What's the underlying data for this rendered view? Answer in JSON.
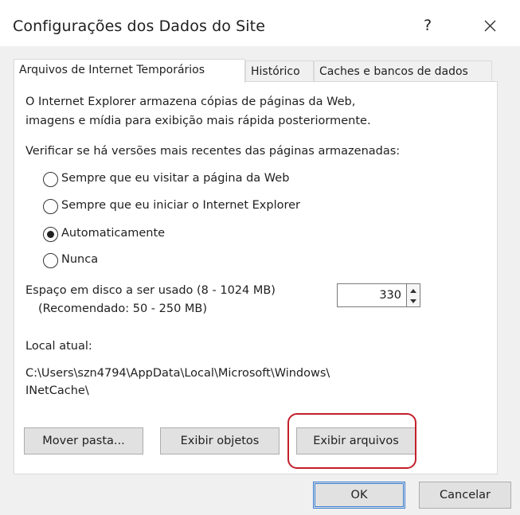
{
  "window": {
    "title": "Configurações dos Dados do Site",
    "help_label": "?"
  },
  "tabs": [
    {
      "label": "Arquivos de Internet Temporários",
      "active": true
    },
    {
      "label": "Histórico",
      "active": false
    },
    {
      "label": "Caches e bancos de dados",
      "active": false
    }
  ],
  "panel": {
    "description_line1": "O Internet Explorer armazena cópias de páginas da Web,",
    "description_line2": "imagens e mídia para exibição mais rápida posteriormente.",
    "check_label": "Verificar se há versões mais recentes das páginas armazenadas:",
    "radio_options": [
      {
        "label": "Sempre que eu visitar a página da Web",
        "selected": false
      },
      {
        "label": "Sempre que eu iniciar o Internet Explorer",
        "selected": false
      },
      {
        "label": "Automaticamente",
        "selected": true
      },
      {
        "label": "Nunca",
        "selected": false
      }
    ],
    "disk_label_line1": "Espaço em disco a ser usado (8 - 1024 MB)",
    "disk_label_line2": "(Recomendado: 50 - 250 MB)",
    "disk_value": "330",
    "location_label": "Local atual:",
    "location_path_line1": "C:\\Users\\szn4794\\AppData\\Local\\Microsoft\\Windows\\",
    "location_path_line2": "INetCache\\",
    "move_button": "Mover pasta...",
    "view_objects_button": "Exibir objetos",
    "view_files_button": "Exibir arquivos"
  },
  "footer": {
    "ok_label": "OK",
    "cancel_label": "Cancelar"
  },
  "colors": {
    "highlight": "#c21f2b",
    "ok_border": "#3b7fd4"
  },
  "icons": [
    "close-icon",
    "spin-up-icon",
    "spin-down-icon"
  ]
}
